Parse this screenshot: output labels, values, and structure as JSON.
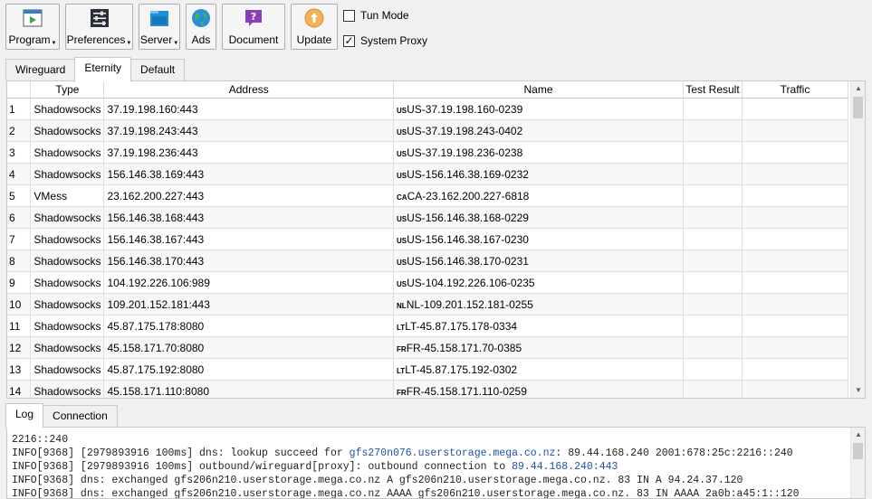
{
  "toolbar": {
    "buttons": [
      {
        "label": "Program",
        "icon": "program-icon",
        "dropdown": true
      },
      {
        "label": "Preferences",
        "icon": "preferences-icon",
        "dropdown": true
      },
      {
        "label": "Server",
        "icon": "server-icon",
        "dropdown": true
      },
      {
        "label": "Ads",
        "icon": "globe-icon",
        "dropdown": false
      },
      {
        "label": "Document",
        "icon": "help-icon",
        "dropdown": false
      },
      {
        "label": "Update",
        "icon": "update-icon",
        "dropdown": false
      }
    ],
    "tun_mode": {
      "label": "Tun Mode",
      "checked": false
    },
    "system_proxy": {
      "label": "System Proxy",
      "checked": true
    }
  },
  "profile_tabs": [
    "Wireguard",
    "Eternity",
    "Default"
  ],
  "active_profile_tab": "Eternity",
  "table": {
    "columns": [
      "",
      "Type",
      "Address",
      "Name",
      "Test Result",
      "Traffic"
    ],
    "rows": [
      {
        "n": "1",
        "type": "Shadowsocks",
        "address": "37.19.198.160:443",
        "flag": "US",
        "name": "US-37.19.198.160-0239"
      },
      {
        "n": "2",
        "type": "Shadowsocks",
        "address": "37.19.198.243:443",
        "flag": "US",
        "name": "US-37.19.198.243-0402"
      },
      {
        "n": "3",
        "type": "Shadowsocks",
        "address": "37.19.198.236:443",
        "flag": "US",
        "name": "US-37.19.198.236-0238"
      },
      {
        "n": "4",
        "type": "Shadowsocks",
        "address": "156.146.38.169:443",
        "flag": "US",
        "name": "US-156.146.38.169-0232"
      },
      {
        "n": "5",
        "type": "VMess",
        "address": "23.162.200.227:443",
        "flag": "CA",
        "name": "CA-23.162.200.227-6818"
      },
      {
        "n": "6",
        "type": "Shadowsocks",
        "address": "156.146.38.168:443",
        "flag": "US",
        "name": "US-156.146.38.168-0229"
      },
      {
        "n": "7",
        "type": "Shadowsocks",
        "address": "156.146.38.167:443",
        "flag": "US",
        "name": "US-156.146.38.167-0230"
      },
      {
        "n": "8",
        "type": "Shadowsocks",
        "address": "156.146.38.170:443",
        "flag": "US",
        "name": "US-156.146.38.170-0231"
      },
      {
        "n": "9",
        "type": "Shadowsocks",
        "address": "104.192.226.106:989",
        "flag": "US",
        "name": "US-104.192.226.106-0235"
      },
      {
        "n": "10",
        "type": "Shadowsocks",
        "address": "109.201.152.181:443",
        "flag": "NL",
        "name": "NL-109.201.152.181-0255"
      },
      {
        "n": "11",
        "type": "Shadowsocks",
        "address": "45.87.175.178:8080",
        "flag": "LT",
        "name": "LT-45.87.175.178-0334"
      },
      {
        "n": "12",
        "type": "Shadowsocks",
        "address": "45.158.171.70:8080",
        "flag": "FR",
        "name": "FR-45.158.171.70-0385"
      },
      {
        "n": "13",
        "type": "Shadowsocks",
        "address": "45.87.175.192:8080",
        "flag": "LT",
        "name": "LT-45.87.175.192-0302"
      },
      {
        "n": "14",
        "type": "Shadowsocks",
        "address": "45.158.171.110:8080",
        "flag": "FR",
        "name": "FR-45.158.171.110-0259"
      }
    ]
  },
  "bottom_tabs": [
    "Log",
    "Connection"
  ],
  "active_bottom_tab": "Log",
  "log_lines": [
    {
      "text": "2216::240"
    },
    {
      "text": "INFO[9368] [2979893916 100ms] dns: lookup succeed for ",
      "link": "gfs270n076.userstorage.mega.co.nz",
      "rest": ": 89.44.168.240 2001:678:25c:2216::240"
    },
    {
      "text": "INFO[9368] [2979893916 100ms] outbound/wireguard[proxy]: outbound connection to ",
      "link": "89.44.168.240:443",
      "rest": ""
    },
    {
      "text": "INFO[9368] dns: exchanged gfs206n210.userstorage.mega.co.nz A gfs206n210.userstorage.mega.co.nz. 83 IN A 94.24.37.120"
    },
    {
      "text": "INFO[9368] dns: exchanged gfs206n210.userstorage.mega.co.nz AAAA gfs206n210.userstorage.mega.co.nz. 83 IN AAAA 2a0b:a45:1::120"
    }
  ],
  "colors": {
    "log_link": "#1f52a8",
    "selection_tab": "#ffffff"
  }
}
